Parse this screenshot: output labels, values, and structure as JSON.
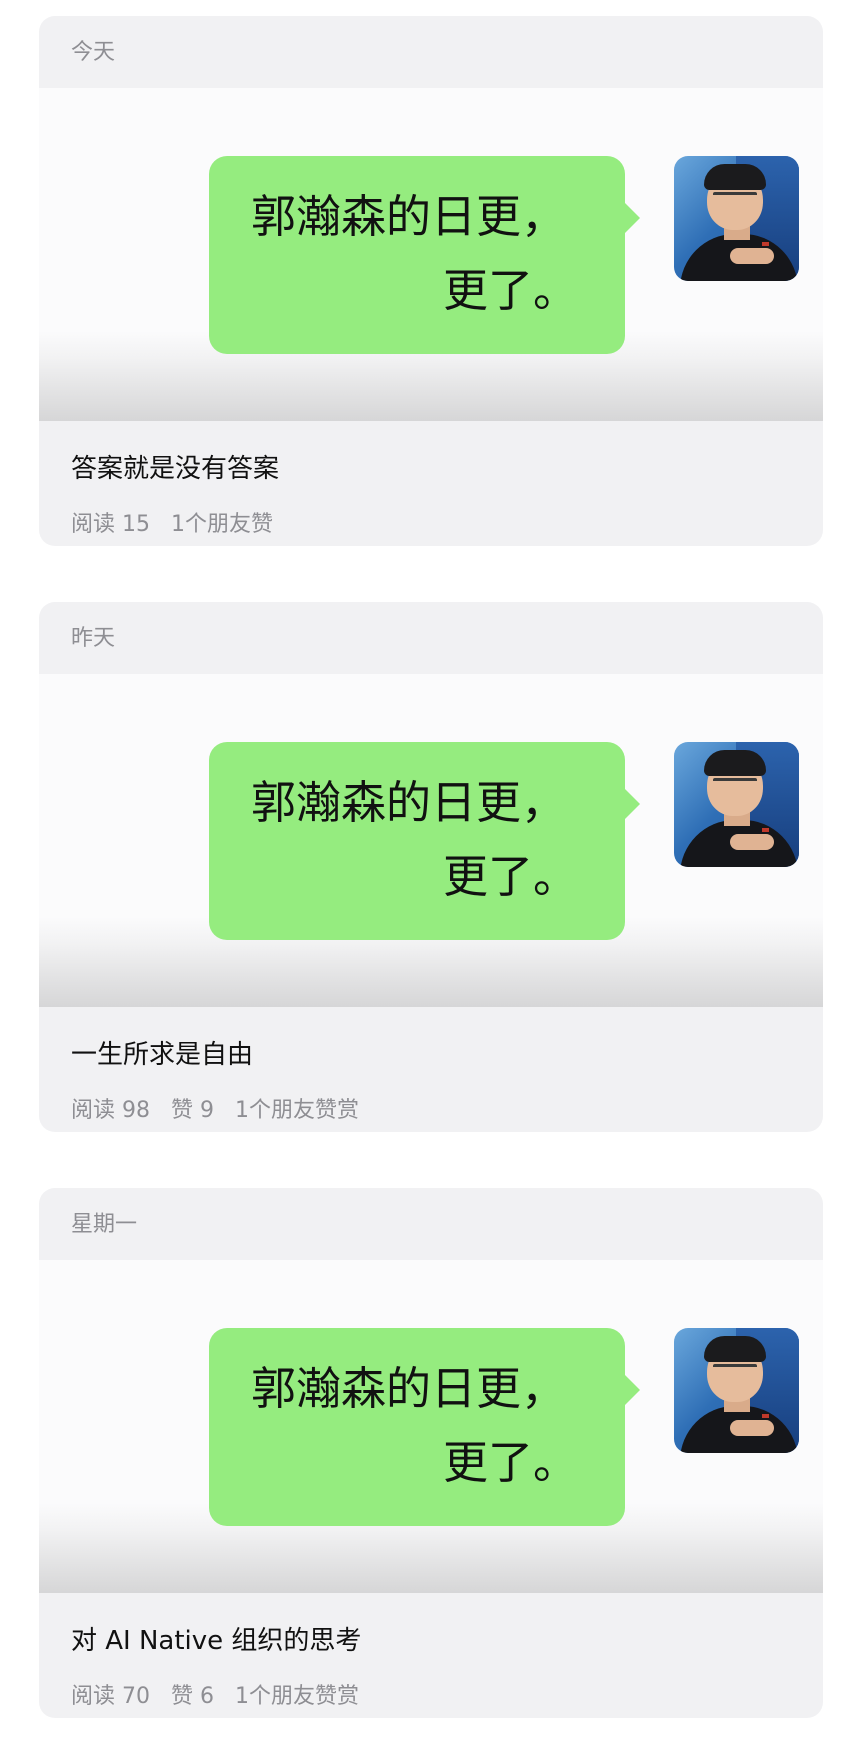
{
  "posts": [
    {
      "date": "今天",
      "cover_line1": "郭瀚森的日更，",
      "cover_line2": "更了。",
      "title": "答案就是没有答案",
      "stats": [
        "阅读 15",
        "1个朋友赞"
      ]
    },
    {
      "date": "昨天",
      "cover_line1": "郭瀚森的日更，",
      "cover_line2": "更了。",
      "title": "一生所求是自由",
      "stats": [
        "阅读 98",
        "赞 9",
        "1个朋友赞赏"
      ]
    },
    {
      "date": "星期一",
      "cover_line1": "郭瀚森的日更，",
      "cover_line2": "更了。",
      "title": "对 AI Native 组织的思考",
      "stats": [
        "阅读 70",
        "赞 6",
        "1个朋友赞赏"
      ]
    }
  ],
  "colors": {
    "card_background": "#f1f1f3",
    "bubble_green": "#95ec7f",
    "muted_text": "#8e8e93"
  }
}
